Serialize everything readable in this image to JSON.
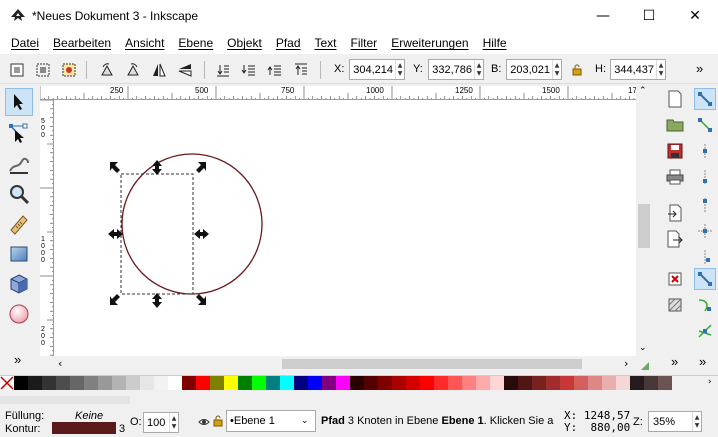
{
  "window": {
    "title": "*Neues Dokument 3 - Inkscape",
    "minimize": "—",
    "maximize": "☐",
    "close": "✕"
  },
  "menu": [
    "Datei",
    "Bearbeiten",
    "Ansicht",
    "Ebene",
    "Objekt",
    "Pfad",
    "Text",
    "Filter",
    "Erweiterungen",
    "Hilfe"
  ],
  "controls": {
    "x_label": "X:",
    "x_value": "304,214",
    "y_label": "Y:",
    "y_value": "332,786",
    "b_label": "B:",
    "b_value": "203,021",
    "h_label": "H:",
    "h_value": "344,437",
    "more": "»"
  },
  "ruler_top_labels": [
    "250",
    "500",
    "750",
    "1000",
    "1250",
    "1500",
    "17"
  ],
  "ruler_left_labels": [
    "5",
    "0",
    "0",
    "1",
    "0",
    "0",
    "0",
    "1",
    "5",
    "0",
    "0",
    "2",
    "0",
    "0"
  ],
  "tools": [
    "select-tool",
    "node-tool",
    "tweak-tool",
    "zoom-tool",
    "measure-tool",
    "rect-tool",
    "3dbox-tool",
    "circle-tool"
  ],
  "toolbox_more": "»",
  "palette": [
    "#000000",
    "#1a1a1a",
    "#333333",
    "#4d4d4d",
    "#666666",
    "#808080",
    "#999999",
    "#b3b3b3",
    "#cccccc",
    "#e6e6e6",
    "#f2f2f2",
    "#ffffff",
    "#800000",
    "#ff0000",
    "#808000",
    "#ffff00",
    "#008000",
    "#00ff00",
    "#008080",
    "#00ffff",
    "#000080",
    "#0000ff",
    "#800080",
    "#ff00ff",
    "#2b0000",
    "#550000",
    "#800000",
    "#aa0000",
    "#d40000",
    "#ff0000",
    "#ff2a2a",
    "#ff5555",
    "#ff8080",
    "#ffaaaa",
    "#ffd5d5",
    "#280b0b",
    "#501616",
    "#782121",
    "#a02c2c",
    "#c83737",
    "#d35f5f",
    "#de8787",
    "#e9afaf",
    "#f4d7d7",
    "#241c1c",
    "#483737",
    "#6c5353"
  ],
  "status": {
    "fill_label": "Füllung:",
    "fill_value": "Keine",
    "stroke_label": "Kontur:",
    "stroke_color": "#5a1a1a",
    "stroke_width": "3",
    "opacity_label": "O:",
    "opacity_value": "100",
    "layer": "•Ebene 1",
    "message_bold1": "Pfad",
    "message_mid": " 3 Knoten in Ebene ",
    "message_bold2": "Ebene 1",
    "message_tail": ". Klicken Sie a",
    "cursor_x": "X: 1248,57",
    "cursor_y": "Y:  880,00",
    "zoom_label": "Z:",
    "zoom_value": "35%"
  },
  "colors": {
    "circle_stroke": "#6b1a1a",
    "active_tool": "#cde4f7"
  }
}
